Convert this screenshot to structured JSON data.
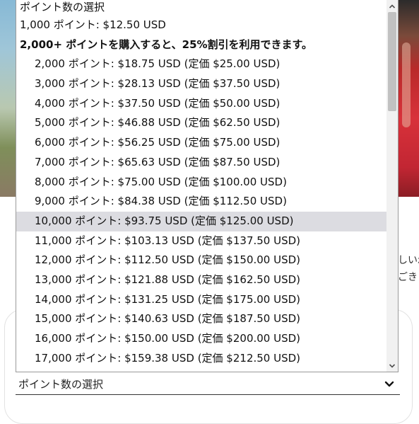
{
  "background": {
    "snippet_line1": "しい示",
    "snippet_line2": "ごきま"
  },
  "select": {
    "selected_label": "ポイント数の選択",
    "chevron_icon": "chevron-down-icon"
  },
  "dropdown": {
    "placeholder": "ポイント数の選択",
    "single_option": "1,000 ポイント: $12.50 USD",
    "group_label": "2,000+ ポイントを購入すると、25%割引を利用できます。",
    "group_options": [
      "2,000 ポイント: $18.75 USD (定価 $25.00 USD)",
      "3,000 ポイント: $28.13 USD (定価 $37.50 USD)",
      "4,000 ポイント: $37.50 USD (定価 $50.00 USD)",
      "5,000 ポイント: $46.88 USD (定価 $62.50 USD)",
      "6,000 ポイント: $56.25 USD (定価 $75.00 USD)",
      "7,000 ポイント: $65.63 USD (定価 $87.50 USD)",
      "8,000 ポイント: $75.00 USD (定価 $100.00 USD)",
      "9,000 ポイント: $84.38 USD (定価 $112.50 USD)",
      "10,000 ポイント: $93.75 USD (定価 $125.00 USD)",
      "11,000 ポイント: $103.13 USD (定価 $137.50 USD)",
      "12,000 ポイント: $112.50 USD (定価 $150.00 USD)",
      "13,000 ポイント: $121.88 USD (定価 $162.50 USD)",
      "14,000 ポイント: $131.25 USD (定価 $175.00 USD)",
      "15,000 ポイント: $140.63 USD (定価 $187.50 USD)",
      "16,000 ポイント: $150.00 USD (定価 $200.00 USD)",
      "17,000 ポイント: $159.38 USD (定価 $212.50 USD)"
    ],
    "highlighted_option": "10,000 ポイント: $93.75 USD (定価 $125.00 USD)"
  },
  "colors": {
    "highlight": "#dcdce1",
    "scroll_thumb": "#c1c1c1"
  }
}
